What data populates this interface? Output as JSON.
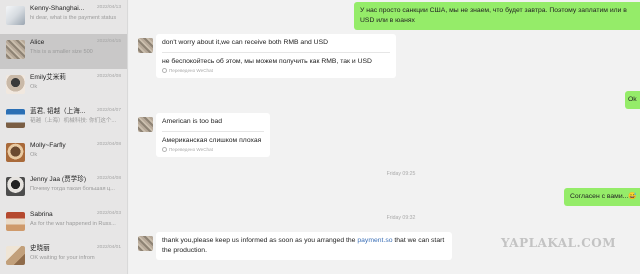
{
  "sidebar": {
    "items": [
      {
        "name": "Kenny-Shanghai...",
        "date": "2022/04/13",
        "preview": "hi dear, what is the payment status"
      },
      {
        "name": "Alice",
        "date": "2022/04/15",
        "preview": "This is a smaller size 500"
      },
      {
        "name": "Emily艾米莉",
        "date": "2022/04/08",
        "preview": "Ok"
      },
      {
        "name": "蓝君, 韬越（上海...",
        "date": "2022/04/07",
        "preview": "韬越（上海）机械科技: 你们这个..."
      },
      {
        "name": "Molly~Farfly",
        "date": "2022/04/08",
        "preview": "Ok"
      },
      {
        "name": "Jenny Jaa (贾学珍)",
        "date": "2022/04/08",
        "preview": "Почему тогда такая большая ц..."
      },
      {
        "name": "Sabrina",
        "date": "2022/04/03",
        "preview": "As for the war happened in Russ..."
      },
      {
        "name": "史晓丽",
        "date": "2022/04/01",
        "preview": "OK waiting for your infrom"
      }
    ]
  },
  "conversation": {
    "msg1_out": "У нас просто санкции США, мы не знаем, что будет завтра. Поэтому заплатим или в USD или в юанях",
    "msg2_in": "don't worry about it,we can receive both RMB and USD",
    "msg2_translation": "не беспокойтесь об этом, мы можем получить как RMB, так и USD",
    "translated_note": "Переведено WeChat",
    "msg3_out": "Ok",
    "msg4_in": "American is too bad",
    "msg4_translation": "Американская слишком плохая",
    "time1": "Friday 09:25",
    "msg5_out": "Согласен с вами...",
    "msg5_emoji": "😅",
    "time2": "Friday 09:32",
    "msg6_part1": "thank you,please keep us informed as soon as you arranged the ",
    "msg6_link": "payment.so",
    "msg6_part2": " that we can start the production."
  },
  "watermark": "YAPLAKAL.COM"
}
